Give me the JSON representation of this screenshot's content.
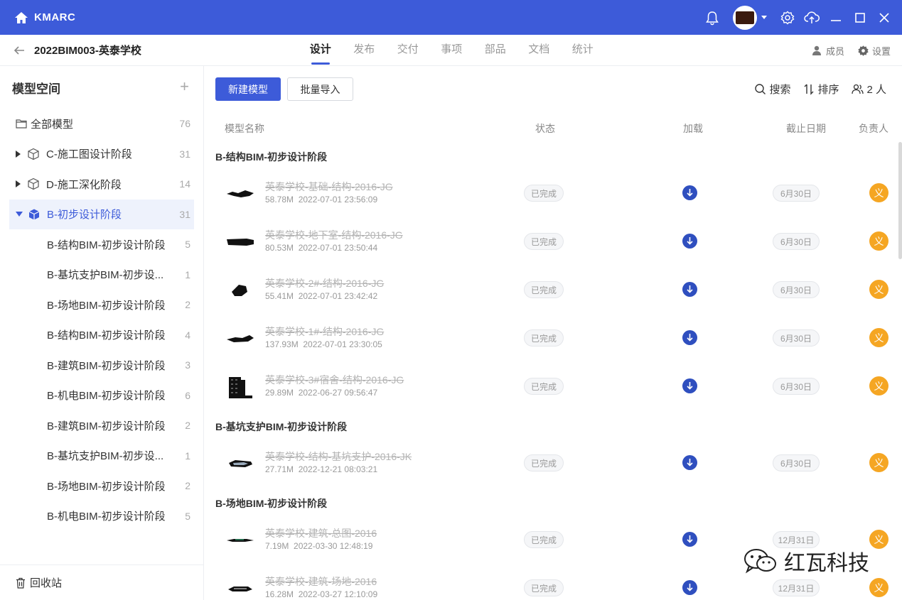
{
  "app": {
    "brand": "KMARC",
    "icons": [
      "home-icon",
      "bell-icon",
      "gear-icon",
      "cloud-upload-icon",
      "minimize-icon",
      "maximize-icon",
      "close-icon"
    ]
  },
  "project": {
    "title": "2022BIM003-英泰学校",
    "tabs": [
      {
        "label": "设计",
        "active": true
      },
      {
        "label": "发布"
      },
      {
        "label": "交付"
      },
      {
        "label": "事项"
      },
      {
        "label": "部品"
      },
      {
        "label": "文档"
      },
      {
        "label": "统计"
      }
    ],
    "members_label": "成员",
    "settings_label": "设置"
  },
  "sidebar": {
    "title": "模型空间",
    "all": {
      "label": "全部模型",
      "count": "76"
    },
    "groups": [
      {
        "label": "C-施工图设计阶段",
        "count": "31"
      },
      {
        "label": "D-施工深化阶段",
        "count": "14"
      },
      {
        "label": "B-初步设计阶段",
        "count": "31"
      }
    ],
    "children": [
      {
        "label": "B-结构BIM-初步设计阶段",
        "count": "5"
      },
      {
        "label": "B-基坑支护BIM-初步设...",
        "count": "1"
      },
      {
        "label": "B-场地BIM-初步设计阶段",
        "count": "2"
      },
      {
        "label": "B-结构BIM-初步设计阶段",
        "count": "4"
      },
      {
        "label": "B-建筑BIM-初步设计阶段",
        "count": "3"
      },
      {
        "label": "B-机电BIM-初步设计阶段",
        "count": "6"
      },
      {
        "label": "B-建筑BIM-初步设计阶段",
        "count": "2"
      },
      {
        "label": "B-基坑支护BIM-初步设...",
        "count": "1"
      },
      {
        "label": "B-场地BIM-初步设计阶段",
        "count": "2"
      },
      {
        "label": "B-机电BIM-初步设计阶段",
        "count": "5"
      }
    ],
    "recycle": "回收站"
  },
  "toolbar": {
    "new_model": "新建模型",
    "bulk_import": "批量导入",
    "search": "搜索",
    "sort": "排序",
    "people": "2 人"
  },
  "columns": {
    "name": "模型名称",
    "status": "状态",
    "load": "加载",
    "due": "截止日期",
    "owner": "负责人"
  },
  "groups": [
    {
      "title": "B-结构BIM-初步设计阶段"
    },
    {
      "title": "B-基坑支护BIM-初步设计阶段"
    },
    {
      "title": "B-场地BIM-初步设计阶段"
    }
  ],
  "rows": [
    {
      "name": "英泰学校-基础-结构-2016-JG",
      "size": "58.78M",
      "time": "2022-07-01 23:56:09",
      "status": "已完成",
      "due": "6月30日",
      "owner": "义"
    },
    {
      "name": "英泰学校-地下室-结构-2016-JG",
      "size": "80.53M",
      "time": "2022-07-01 23:50:44",
      "status": "已完成",
      "due": "6月30日",
      "owner": "义"
    },
    {
      "name": "英泰学校-2#-结构-2016-JG",
      "size": "55.41M",
      "time": "2022-07-01 23:42:42",
      "status": "已完成",
      "due": "6月30日",
      "owner": "义"
    },
    {
      "name": "英泰学校-1#-结构-2016-JG",
      "size": "137.93M",
      "time": "2022-07-01 23:30:05",
      "status": "已完成",
      "due": "6月30日",
      "owner": "义"
    },
    {
      "name": "英泰学校-3#宿舍-结构-2016-JG",
      "size": "29.89M",
      "time": "2022-06-27 09:56:47",
      "status": "已完成",
      "due": "6月30日",
      "owner": "义"
    },
    {
      "name": "英泰学校-结构-基坑支护-2016-JK",
      "size": "27.71M",
      "time": "2022-12-21 08:03:21",
      "status": "已完成",
      "due": "6月30日",
      "owner": "义"
    },
    {
      "name": "英泰学校-建筑-总图-2016",
      "size": "7.19M",
      "time": "2022-03-30 12:48:19",
      "status": "已完成",
      "due": "12月31日",
      "owner": "义"
    },
    {
      "name": "英泰学校-建筑-场地-2016",
      "size": "16.28M",
      "time": "2022-03-27 12:10:09",
      "status": "已完成",
      "due": "12月31日",
      "owner": "义"
    }
  ],
  "watermark": "红瓦科技",
  "colors": {
    "primary": "#3d5bd9",
    "owner": "#f5a623",
    "load": "#2f4fbf"
  }
}
